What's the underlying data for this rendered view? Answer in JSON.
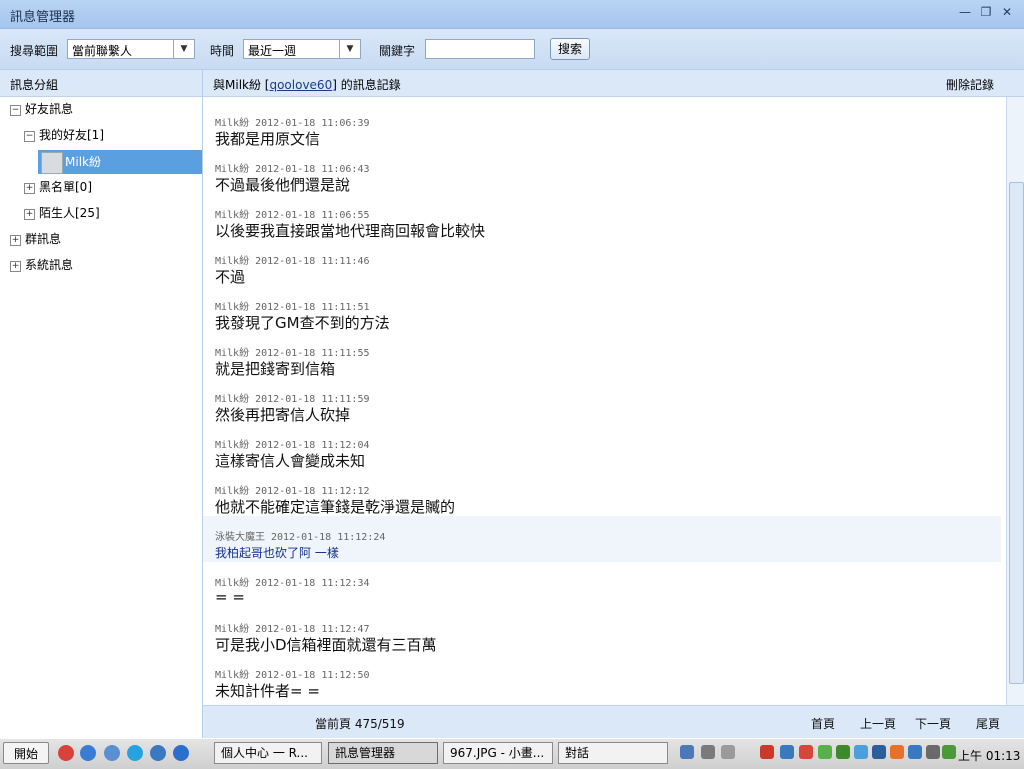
{
  "window": {
    "title": "訊息管理器"
  },
  "toolbar": {
    "scope_label": "搜尋範圍",
    "scope_value": "當前聯繫人",
    "time_label": "時間",
    "time_value": "最近一週",
    "keyword_label": "關鍵字",
    "keyword_value": "",
    "search_label": "搜索"
  },
  "sidebar": {
    "title": "訊息分組",
    "items": [
      {
        "label": "好友訊息",
        "expander": "⊟"
      },
      {
        "label": "我的好友[1]",
        "expander": "⊟"
      },
      {
        "label": "Milk紛"
      },
      {
        "label": "黑名單[0]",
        "expander": "⊞"
      },
      {
        "label": "陌生人[25]",
        "expander": "⊞"
      },
      {
        "label": "群訊息",
        "expander": "⊞"
      },
      {
        "label": "系統訊息",
        "expander": "⊞"
      }
    ]
  },
  "header": {
    "prefix": "與Milk紛 [",
    "contact_id": "qoolove60",
    "suffix": "] 的訊息記錄",
    "delete_label": "刪除記錄"
  },
  "messages": [
    {
      "sender": "Milk紛",
      "time": "2012-01-18 11:06:39",
      "text": "我都是用原文信"
    },
    {
      "sender": "Milk紛",
      "time": "2012-01-18 11:06:43",
      "text": "不過最後他們還是說"
    },
    {
      "sender": "Milk紛",
      "time": "2012-01-18 11:06:55",
      "text": "以後要我直接跟當地代理商回報會比較快"
    },
    {
      "sender": "Milk紛",
      "time": "2012-01-18 11:11:46",
      "text": "不過"
    },
    {
      "sender": "Milk紛",
      "time": "2012-01-18 11:11:51",
      "text": "我發現了GM查不到的方法"
    },
    {
      "sender": "Milk紛",
      "time": "2012-01-18 11:11:55",
      "text": "就是把錢寄到信箱"
    },
    {
      "sender": "Milk紛",
      "time": "2012-01-18 11:11:59",
      "text": "然後再把寄信人砍掉"
    },
    {
      "sender": "Milk紛",
      "time": "2012-01-18 11:12:04",
      "text": "這樣寄信人會變成未知"
    },
    {
      "sender": "Milk紛",
      "time": "2012-01-18 11:12:12",
      "text": "他就不能確定這筆錢是乾淨還是贓的"
    },
    {
      "sender": "泳裝大魔王",
      "time": "2012-01-18 11:12:24",
      "text": "我柏起哥也砍了阿 一樣"
    },
    {
      "sender": "Milk紛",
      "time": "2012-01-18 11:12:34",
      "text": "= ="
    },
    {
      "sender": "Milk紛",
      "time": "2012-01-18 11:12:47",
      "text": "可是我小D信箱裡面就還有三百萬"
    },
    {
      "sender": "Milk紛",
      "time": "2012-01-18 11:12:50",
      "text": "未知計件者= ="
    }
  ],
  "footer": {
    "page_info": "當前頁 475/519",
    "first": "首頁",
    "prev": "上一頁",
    "next": "下一頁",
    "last": "尾頁"
  },
  "taskbar": {
    "start": "開始",
    "tasks": [
      "個人中心 一 R...",
      "訊息管理器",
      "967.JPG - 小畫...",
      "對話"
    ],
    "clock": "上午 01:13"
  }
}
